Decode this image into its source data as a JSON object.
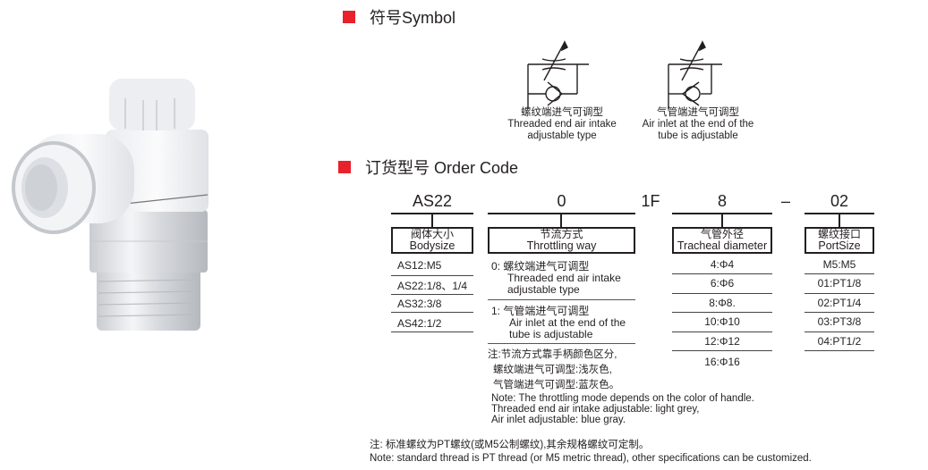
{
  "product_image": {
    "alt": "White speed control elbow fitting with chrome threaded body",
    "icon": "pneumatic-fitting-photo"
  },
  "symbol_section": {
    "marker_color": "#e8212b",
    "title": "符号Symbol",
    "symbols": [
      {
        "icon": "throttle-valve-threaded-symbol",
        "label_cn": "螺纹端进气可调型",
        "label_en_1": "Threaded end air intake",
        "label_en_2": "adjustable type"
      },
      {
        "icon": "throttle-valve-tube-symbol",
        "label_cn": "气管端进气可调型",
        "label_en_1": "Air inlet at the end of the",
        "label_en_2": "tube is adjustable"
      }
    ]
  },
  "order_section": {
    "marker_color": "#e8212b",
    "title": "订货型号 Order Code",
    "code_parts": {
      "body": "AS22",
      "throttle": "0",
      "fixed": "1F",
      "diameter": "8",
      "dash": "–",
      "port": "02"
    },
    "headers": {
      "body": {
        "cn": "阀体大小",
        "en": "Bodysize"
      },
      "throttle": {
        "cn": "节流方式",
        "en": "Throttling way"
      },
      "diameter": {
        "cn": "气管外径",
        "en": "Tracheal diameter"
      },
      "port": {
        "cn": "螺纹接口",
        "en": "PortSize"
      }
    },
    "body_sizes": [
      "AS12:M5",
      "AS22:1/8、1/4",
      "AS32:3/8",
      "AS42:1/2"
    ],
    "throttle_ways": [
      {
        "code": "0:",
        "cn": "螺纹端进气可调型",
        "en_1": "Threaded end air intake",
        "en_2": "adjustable type"
      },
      {
        "code": "1:",
        "cn": "气管端进气可调型",
        "en_1": "Air inlet at the end of the",
        "en_2": "tube is adjustable"
      }
    ],
    "throttle_note": {
      "cn_1": "注:节流方式靠手柄颜色区分,",
      "cn_2": "螺纹端进气可调型:浅灰色,",
      "cn_3": "气管端进气可调型:蓝灰色。",
      "en_1": "Note: The throttling mode depends on the color of handle.",
      "en_2": "Threaded end air intake adjustable: light grey,",
      "en_3": "Air inlet adjustable: blue gray."
    },
    "diameters": [
      "4:Φ4",
      "6:Φ6",
      "8:Φ8.",
      "10:Φ10",
      "12:Φ12",
      "16:Φ16"
    ],
    "port_sizes": [
      "M5:M5",
      "01:PT1/8",
      "02:PT1/4",
      "03:PT3/8",
      "04:PT1/2"
    ]
  },
  "footer_note": {
    "cn": "注:  标准螺纹为PT螺纹(或M5公制螺纹),其余规格螺纹可定制。",
    "en": "Note: standard thread is PT thread (or M5 metric thread), other specifications can be customized."
  }
}
